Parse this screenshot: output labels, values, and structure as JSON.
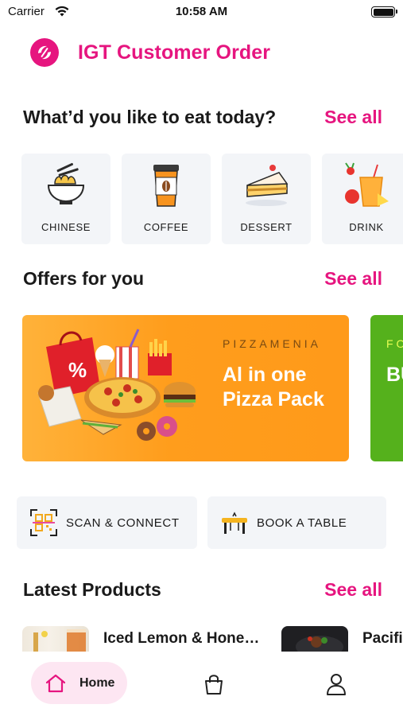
{
  "status_bar": {
    "carrier": "Carrier",
    "time": "10:58 AM"
  },
  "header": {
    "title": "IGT Customer Order",
    "logo_icon": "fork-knife-logo-icon"
  },
  "categories_section": {
    "title": "What’d you like to eat today?",
    "see_all": "See all",
    "items": [
      {
        "label": "CHINESE",
        "icon": "noodle-bowl-icon"
      },
      {
        "label": "COFFEE",
        "icon": "coffee-cup-icon"
      },
      {
        "label": "DESSERT",
        "icon": "cake-slice-icon"
      },
      {
        "label": "DRINK",
        "icon": "fruit-drink-icon"
      }
    ]
  },
  "offers_section": {
    "title": "Offers for you",
    "see_all": "See all",
    "cards": [
      {
        "brand": "PIZZAMENIA",
        "title": "Al in one Pizza Pack"
      },
      {
        "brand": "FO",
        "title": "BU G FR"
      }
    ]
  },
  "quick_actions": {
    "scan": {
      "label": "SCAN & CONNECT",
      "icon": "qr-scan-icon"
    },
    "book": {
      "label": "BOOK A TABLE",
      "icon": "table-icon"
    }
  },
  "latest_section": {
    "title": "Latest Products",
    "see_all": "See all",
    "products": [
      {
        "name": "Iced Lemon & Hone…"
      },
      {
        "name": "Pacifi"
      }
    ]
  },
  "tab_bar": {
    "home_label": "Home",
    "icons": [
      "home-icon",
      "shopping-bag-icon",
      "profile-icon"
    ]
  },
  "colors": {
    "accent": "#e6157f",
    "offer_orange": "#ff9d1c",
    "offer_green": "#55b11c",
    "card_bg": "#f3f5f8",
    "home_tab_bg": "#fde6f2"
  }
}
